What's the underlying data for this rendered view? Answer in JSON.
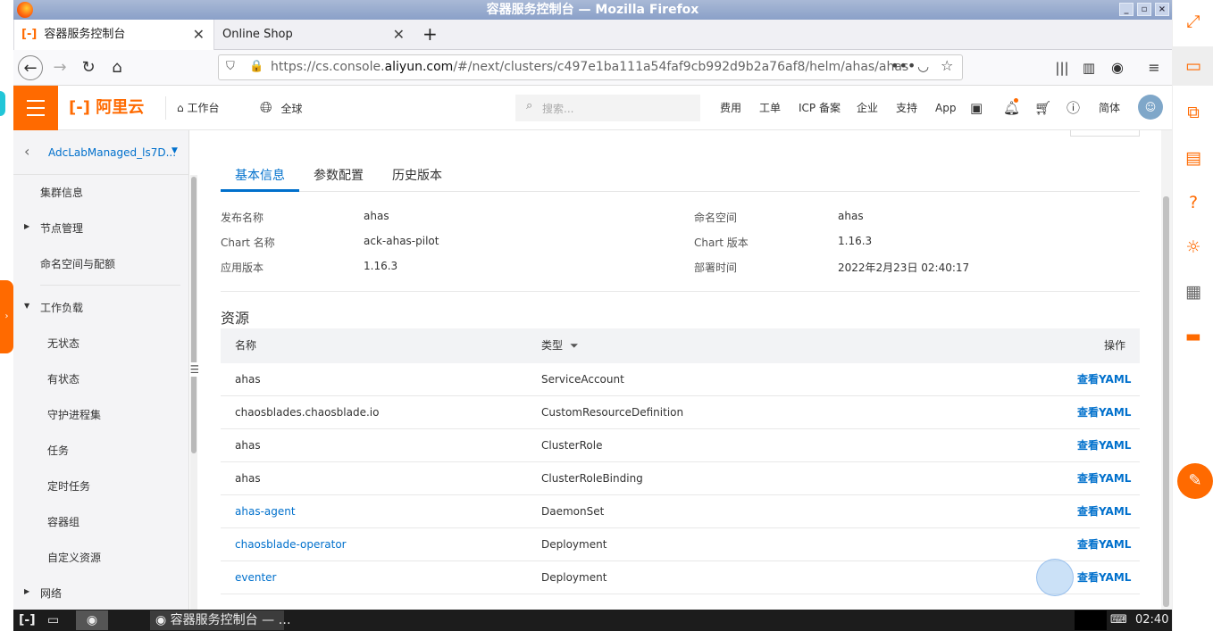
{
  "window": {
    "title": "容器服务控制台 — Mozilla Firefox"
  },
  "browser": {
    "tabs": [
      {
        "label": "容器服务控制台",
        "active": true
      },
      {
        "label": "Online Shop",
        "active": false
      }
    ],
    "url_prefix": "https://cs.console.",
    "url_domain": "aliyun.com",
    "url_suffix": "/#/next/clusters/c497e1ba111a54faf9cb992d9b2a76af8/helm/ahas/ahas"
  },
  "header": {
    "logo_text": "阿里云",
    "workbench": "工作台",
    "region": "全球",
    "search_placeholder": "搜索...",
    "links": [
      "费用",
      "工单",
      "ICP 备案",
      "企业",
      "支持",
      "App"
    ],
    "lang": "简体"
  },
  "sidebar": {
    "cluster_name": "AdcLabManaged_ls7D...",
    "items": [
      {
        "label": "集群信息"
      },
      {
        "label": "节点管理"
      },
      {
        "label": "命名空间与配额"
      },
      {
        "label": "工作负载"
      },
      {
        "label": "无状态"
      },
      {
        "label": "有状态"
      },
      {
        "label": "守护进程集"
      },
      {
        "label": "任务"
      },
      {
        "label": "定时任务"
      },
      {
        "label": "容器组"
      },
      {
        "label": "自定义资源"
      },
      {
        "label": "网络"
      }
    ]
  },
  "main": {
    "tabs": [
      "基本信息",
      "参数配置",
      "历史版本"
    ],
    "info": {
      "release_name_label": "发布名称",
      "release_name": "ahas",
      "namespace_label": "命名空间",
      "namespace": "ahas",
      "chart_name_label": "Chart 名称",
      "chart_name": "ack-ahas-pilot",
      "chart_version_label": "Chart 版本",
      "chart_version": "1.16.3",
      "app_version_label": "应用版本",
      "app_version": "1.16.3",
      "deploy_time_label": "部署时间",
      "deploy_time": "2022年2月23日 02:40:17"
    },
    "resources_title": "资源",
    "table": {
      "headers": [
        "名称",
        "类型",
        "操作"
      ],
      "action_label": "查看YAML",
      "rows": [
        {
          "name": "ahas",
          "type": "ServiceAccount",
          "link": false
        },
        {
          "name": "chaosblades.chaosblade.io",
          "type": "CustomResourceDefinition",
          "link": false
        },
        {
          "name": "ahas",
          "type": "ClusterRole",
          "link": false
        },
        {
          "name": "ahas",
          "type": "ClusterRoleBinding",
          "link": false
        },
        {
          "name": "ahas-agent",
          "type": "DaemonSet",
          "link": true
        },
        {
          "name": "chaosblade-operator",
          "type": "Deployment",
          "link": true
        },
        {
          "name": "eventer",
          "type": "Deployment",
          "link": true
        }
      ]
    }
  },
  "taskbar": {
    "window_label": "容器服务控制台 — …",
    "clock": "02:40"
  },
  "colors": {
    "accent": "#ff6a00",
    "link": "#0070cc"
  }
}
